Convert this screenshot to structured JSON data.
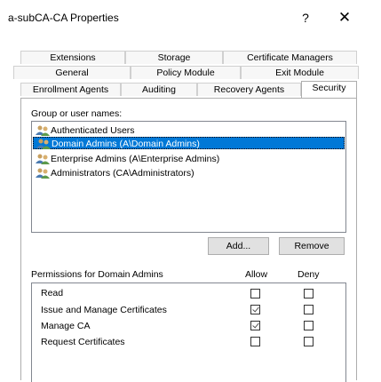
{
  "window": {
    "title": "a-subCA-CA Properties",
    "help_label": "?",
    "close_label": "✕"
  },
  "tabs": {
    "row1": [
      "Extensions",
      "Storage",
      "Certificate Managers"
    ],
    "row2": [
      "General",
      "Policy Module",
      "Exit Module"
    ],
    "row3": [
      "Enrollment Agents",
      "Auditing",
      "Recovery Agents",
      "Security"
    ],
    "active": "Security"
  },
  "security": {
    "group_label": "Group or user names:",
    "users": [
      "Authenticated Users",
      "Domain Admins (A\\Domain Admins)",
      "Enterprise Admins (A\\Enterprise Admins)",
      "Administrators (CA\\Administrators)"
    ],
    "selected_user_index": 1,
    "add_label": "Add...",
    "remove_label": "Remove",
    "permissions_label": "Permissions for Domain Admins",
    "allow_label": "Allow",
    "deny_label": "Deny",
    "permissions": [
      {
        "name": "Read",
        "allow": false,
        "deny": false
      },
      {
        "name": "Issue and Manage Certificates",
        "allow": true,
        "deny": false
      },
      {
        "name": "Manage CA",
        "allow": true,
        "deny": false
      },
      {
        "name": "Request Certificates",
        "allow": false,
        "deny": false
      }
    ]
  },
  "icons": {
    "user_group": "users-icon"
  }
}
